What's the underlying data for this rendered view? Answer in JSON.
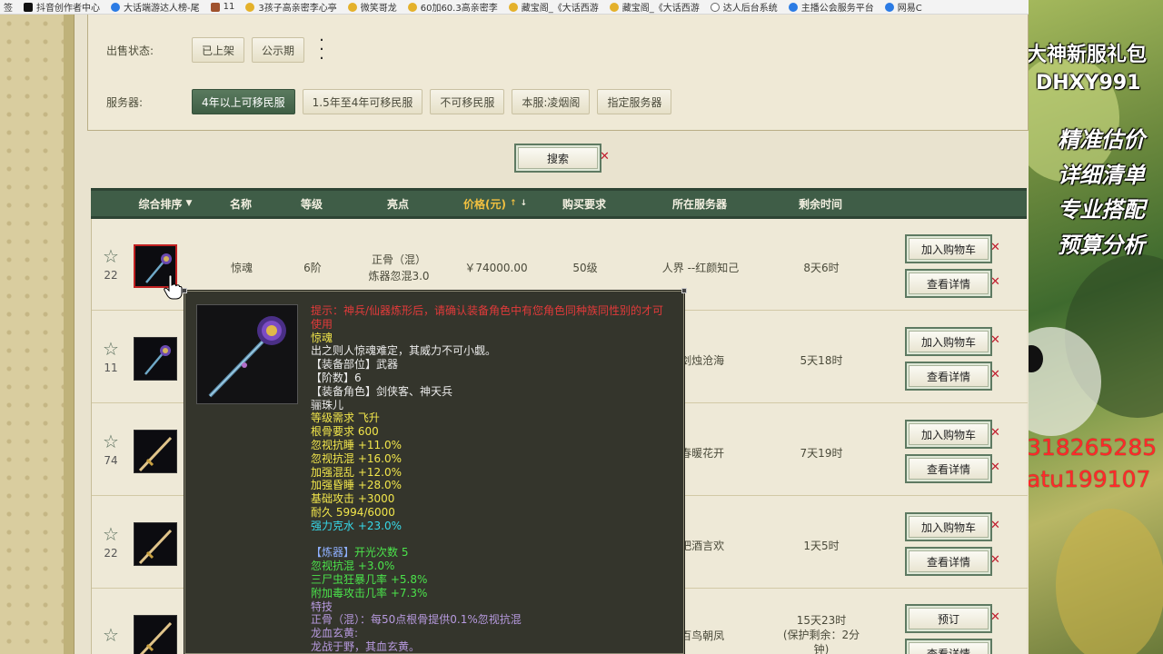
{
  "bookmarks": [
    {
      "label": "签",
      "icon": "none"
    },
    {
      "label": "抖音创作者中心",
      "icon": "tiktok-icon"
    },
    {
      "label": "大话端游达人榜-尾",
      "icon": "browser-icon"
    },
    {
      "label": "11",
      "icon": "game-icon"
    },
    {
      "label": "3孩子高亲密李心亭",
      "icon": "treasure-icon"
    },
    {
      "label": "微笑哥龙",
      "icon": "treasure-icon"
    },
    {
      "label": "60加60.3高亲密李",
      "icon": "treasure-icon"
    },
    {
      "label": "藏宝阁_《大话西游",
      "icon": "treasure-icon"
    },
    {
      "label": "藏宝阁_《大话西游",
      "icon": "treasure-icon"
    },
    {
      "label": "达人后台系统",
      "icon": "globe-icon"
    },
    {
      "label": "主播公会服务平台",
      "icon": "browser-icon"
    },
    {
      "label": "网易C",
      "icon": "browser-icon"
    }
  ],
  "filters": {
    "sale_status": {
      "label": "出售状态:",
      "options": [
        "已上架",
        "公示期"
      ]
    },
    "server": {
      "label": "服务器:",
      "options": [
        "4年以上可移民服",
        "1.5年至4年可移民服",
        "不可移民服",
        "本服:凌烟阁",
        "指定服务器"
      ],
      "active": "4年以上可移民服"
    }
  },
  "search_label": "搜索",
  "table": {
    "headers": {
      "sort": "综合排序",
      "name": "名称",
      "level": "等级",
      "highlight": "亮点",
      "price": "价格(元)",
      "require": "购买要求",
      "server": "所在服务器",
      "remaining": "剩余时间"
    },
    "rows": [
      {
        "favorites": "22",
        "name": "惊魂",
        "level": "6阶",
        "highlight1": "正骨（混）",
        "highlight2": "炼器忽混3.0",
        "price": "￥74000.00",
        "require": "50级",
        "server": "人界 --红颜知己",
        "remaining": "8天6时",
        "btn1": "加入购物车",
        "btn2": "查看详情",
        "item": "staff"
      },
      {
        "favorites": "11",
        "server": "-剑烛沧海",
        "remaining": "5天18时",
        "btn1": "加入购物车",
        "btn2": "查看详情",
        "item": "staff"
      },
      {
        "favorites": "74",
        "server": "-春暖花开",
        "remaining": "7天19时",
        "btn1": "加入购物车",
        "btn2": "查看详情",
        "item": "sword"
      },
      {
        "favorites": "22",
        "server": "-把酒言欢",
        "remaining": "1天5时",
        "btn1": "加入购物车",
        "btn2": "查看详情",
        "item": "sword"
      },
      {
        "favorites": "",
        "server": "-百鸟朝凤",
        "remaining": "15天23时",
        "remaining2": "(保护剩余：2分",
        "remaining3": "钟)",
        "btn1": "预订",
        "btn2": "查看详情",
        "item": "sword"
      }
    ]
  },
  "tooltip": {
    "warning": "提示：神兵/仙器炼形后，请确认装备角色中有您角色同种族同性别的才可使用",
    "name": "惊魂",
    "flavor": "出之则人惊魂难定，其威力不可小觑。",
    "slot": "【装备部位】武器",
    "tier": "【阶数】6",
    "roles": "【装备角色】剑侠客、神天兵",
    "owner": "骊珠儿",
    "level_req": "等级需求 飞升",
    "bone_req": "根骨要求 600",
    "stats": [
      "忽视抗睡 +11.0%",
      "忽视抗混 +16.0%",
      "加强混乱 +12.0%",
      "加强昏睡 +28.0%",
      "基础攻击 +3000",
      "耐久 5994/6000"
    ],
    "strong": "强力克水 +23.0%",
    "refine_title": "【炼器】",
    "refine_count": "开光次数 5",
    "refine_stats": [
      "忽视抗混 +3.0%",
      "三尸虫狂暴几率 +5.8%",
      "附加毒攻击几率 +7.3%"
    ],
    "skill_title": "特技",
    "skill_desc": "正骨（混）：每50点根骨提供0.1%忽视抗混",
    "dragon1": "龙血玄黄:",
    "dragon2": "龙战于野，其血玄黄。"
  },
  "side_panel": {
    "line1": "大神新服礼包",
    "line2": "DHXY991",
    "line3": "精准估价",
    "line4": "详细清单",
    "line5": "专业搭配",
    "line6": "预算分析",
    "line7": "318265285",
    "line8": "atu199107"
  }
}
